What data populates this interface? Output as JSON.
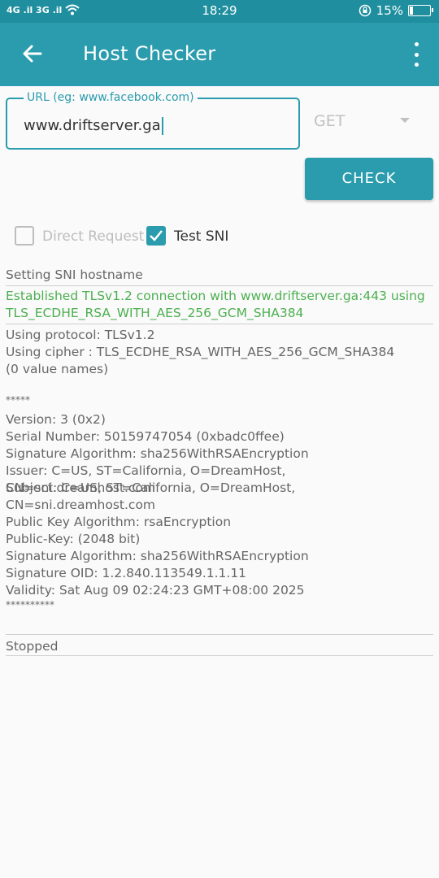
{
  "status_bar": {
    "signal": "4G .il 3G .il",
    "wifi_icon": "wifi-icon",
    "time": "18:29",
    "battery_percent": "15%",
    "battery_level": 0.15
  },
  "app_bar": {
    "title": "Host Checker"
  },
  "form": {
    "url_label": "URL (eg: www.facebook.com)",
    "url_value": "www.driftserver.ga",
    "method": "GET",
    "check_label": "CHECK",
    "direct_request_label": "Direct Request",
    "direct_request_checked": false,
    "test_sni_label": "Test SNI",
    "test_sni_checked": true
  },
  "log": {
    "setting": "Setting SNI hostname",
    "established": "Established TLSv1.2 connection with www.driftserver.ga:443 using TLS_ECDHE_RSA_WITH_AES_256_GCM_SHA384",
    "protocol": "Using protocol: TLSv1.2",
    "cipher": "Using cipher : TLS_ECDHE_RSA_WITH_AES_256_GCM_SHA384",
    "value_names": "(0 value names)",
    "stars_open": "*****",
    "version": "Version: 3 (0x2)",
    "serial": "Serial Number: 50159747054 (0xbadc0ffee)",
    "sig_alg": "Signature Algorithm: sha256WithRSAEncryption",
    "issuer": "Issuer: C=US, ST=California, O=DreamHost, CN=sni.dreamhost.com",
    "subject": "Subject: C=US, ST=California, O=DreamHost, CN=sni.dreamhost.com",
    "pubkey_alg": "Public Key Algorithm: rsaEncryption",
    "pubkey": "Public-Key: (2048 bit)",
    "sig_alg2": "Signature Algorithm: sha256WithRSAEncryption",
    "sig_oid": "Signature OID: 1.2.840.113549.1.1.11",
    "validity": "Validity: Sat Aug 09 02:24:23 GMT+08:00 2025",
    "stars_close": "**********",
    "stopped": "Stopped"
  }
}
